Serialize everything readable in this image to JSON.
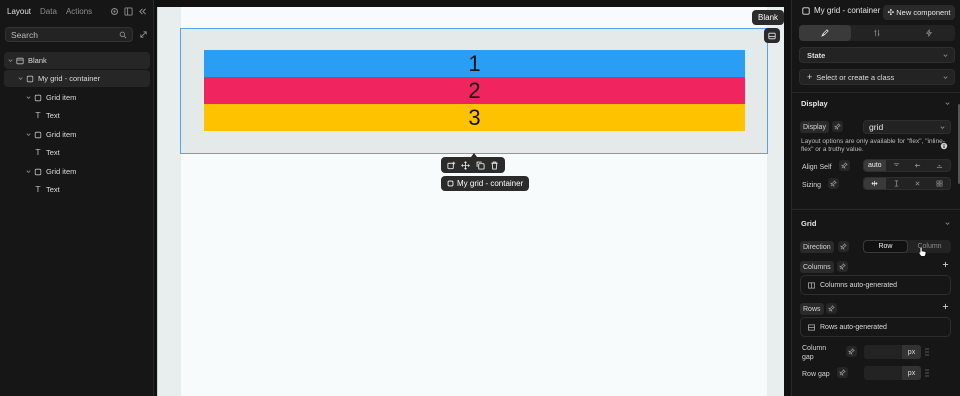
{
  "left_panel": {
    "tabs": [
      "Layout",
      "Data",
      "Actions"
    ],
    "search": {
      "placeholder": "Search"
    },
    "tree": [
      {
        "label": "Blank"
      },
      {
        "label": "My grid - container"
      },
      {
        "label": "Grid item"
      },
      {
        "label": "Text"
      },
      {
        "label": "Grid item"
      },
      {
        "label": "Text"
      },
      {
        "label": "Grid item"
      },
      {
        "label": "Text"
      }
    ]
  },
  "canvas": {
    "page_badge": "Blank",
    "grid_items": [
      {
        "label": "1",
        "color": "#2a9df4"
      },
      {
        "label": "2",
        "color": "#f0245e"
      },
      {
        "label": "3",
        "color": "#ffc200"
      }
    ],
    "selection_tag": "My grid - container",
    "selection_color": "#57a5e6"
  },
  "right_panel": {
    "header": {
      "title": "My grid - container",
      "new_component": "New component"
    },
    "state": {
      "label": "State"
    },
    "class_select": {
      "label": "Select or create a class"
    },
    "display_section": {
      "title": "Display",
      "display_label": "Display",
      "display_value": "grid",
      "note": "Layout options are only available for \"flex\", \"inline-flex\" or a truthy value.",
      "align_self_label": "Align Self",
      "align_self_value": "auto",
      "sizing_label": "Sizing"
    },
    "grid_section": {
      "title": "Grid",
      "direction_label": "Direction",
      "direction_options": [
        "Row",
        "Column"
      ],
      "direction_selected": "Row",
      "columns_label": "Columns",
      "columns_value": "Columns auto-generated",
      "rows_label": "Rows",
      "rows_value": "Rows auto-generated",
      "column_gap_label": "Column gap",
      "column_gap_unit": "px",
      "row_gap_label": "Row gap",
      "row_gap_unit": "px"
    }
  }
}
